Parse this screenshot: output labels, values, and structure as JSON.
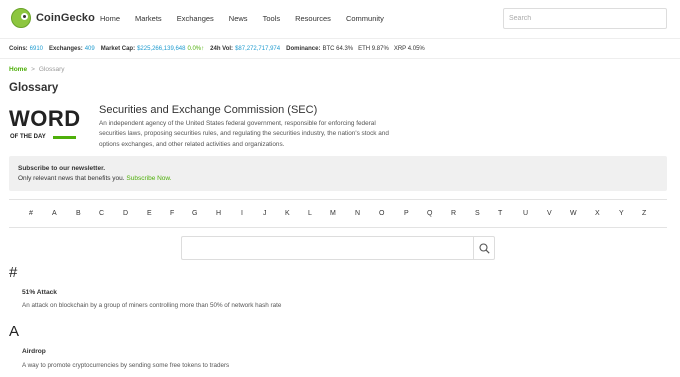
{
  "header": {
    "brand": "CoinGecko",
    "nav": [
      "Home",
      "Markets",
      "Exchanges",
      "News",
      "Tools",
      "Resources",
      "Community"
    ],
    "search_placeholder": "Search"
  },
  "stats": {
    "coins_label": "Coins:",
    "coins_value": "6910",
    "exchanges_label": "Exchanges:",
    "exchanges_value": "409",
    "marketcap_label": "Market Cap:",
    "marketcap_value": "$225,266,139,648",
    "marketcap_change": "0.0%↑",
    "vol_label": "24h Vol:",
    "vol_value": "$87,272,717,974",
    "dominance_label": "Dominance:",
    "dominance_btc": "BTC 64.3%",
    "dominance_eth": "ETH 9.87%",
    "dominance_xrp": "XRP 4.05%"
  },
  "breadcrumb": {
    "home": "Home",
    "separator": ">",
    "current": "Glossary"
  },
  "page_title": "Glossary",
  "word_of_day": {
    "logo_word": "WORD",
    "logo_sub": "OF THE DAY",
    "term": "Securities and Exchange Commission (SEC)",
    "definition": "An independent agency of the United States federal government, responsible for enforcing federal securities laws, proposing securities rules, and regulating the securities industry, the nation's stock and options exchanges, and other related activities and organizations."
  },
  "newsletter": {
    "title": "Subscribe to our newsletter.",
    "subtitle": "Only relevant news that benefits you.",
    "link": "Subscribe Now."
  },
  "alphabet": [
    "#",
    "A",
    "B",
    "C",
    "D",
    "E",
    "F",
    "G",
    "H",
    "I",
    "J",
    "K",
    "L",
    "M",
    "N",
    "O",
    "P",
    "Q",
    "R",
    "S",
    "T",
    "U",
    "V",
    "W",
    "X",
    "Y",
    "Z"
  ],
  "glossary_search": {
    "placeholder": "",
    "icon": "search-icon"
  },
  "sections": [
    {
      "heading": "#",
      "terms": [
        {
          "title": "51% Attack",
          "definition": "An attack on blockchain by a group of miners controlling more than 50% of network hash rate"
        }
      ]
    },
    {
      "heading": "A",
      "terms": [
        {
          "title": "Airdrop",
          "definition": "A way to promote cryptocurrencies by sending some free tokens to traders"
        }
      ]
    }
  ],
  "colors": {
    "brand_green": "#8dc63f",
    "link_green": "#4eaf0a",
    "stat_blue": "#1f9bcf"
  }
}
